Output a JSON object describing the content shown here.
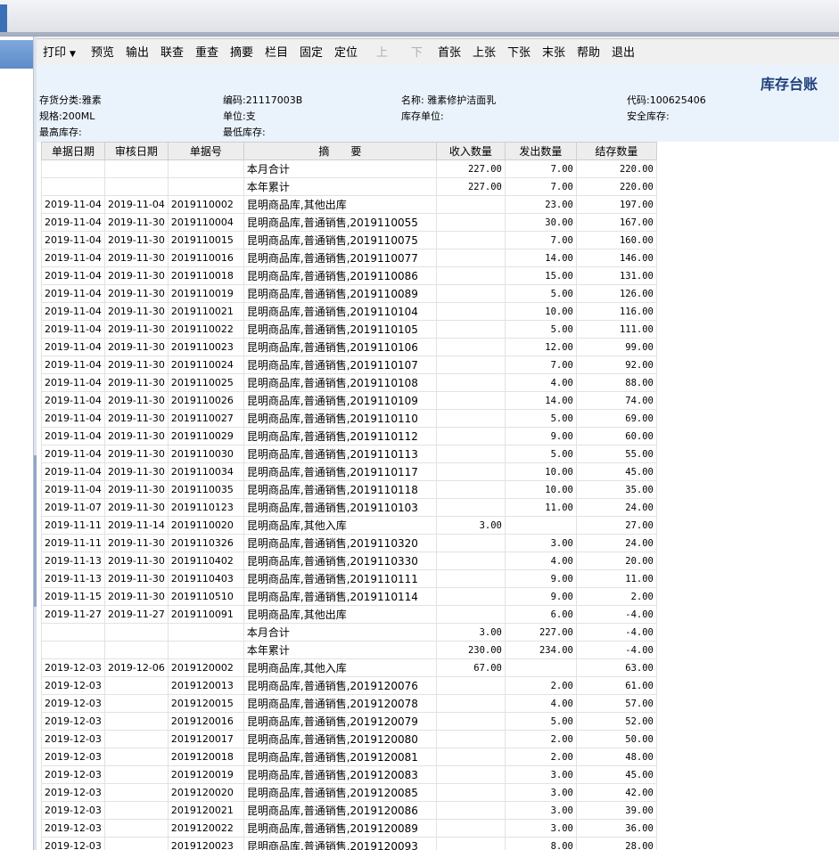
{
  "toolbar": {
    "buttons": [
      {
        "label": "打印",
        "dropdown": true,
        "enabled": true
      },
      {
        "label": "预览",
        "enabled": true
      },
      {
        "label": "输出",
        "enabled": true
      },
      {
        "label": "联查",
        "enabled": true
      },
      {
        "label": "重查",
        "enabled": true
      },
      {
        "label": "摘要",
        "enabled": true
      },
      {
        "label": "栏目",
        "enabled": true
      },
      {
        "label": "固定",
        "enabled": true
      },
      {
        "label": "定位",
        "enabled": true
      },
      {
        "label": "上",
        "enabled": false
      },
      {
        "label": "下",
        "enabled": false
      },
      {
        "label": "首张",
        "enabled": true
      },
      {
        "label": "上张",
        "enabled": true
      },
      {
        "label": "下张",
        "enabled": true
      },
      {
        "label": "末张",
        "enabled": true
      },
      {
        "label": "帮助",
        "enabled": true
      },
      {
        "label": "退出",
        "enabled": true
      }
    ]
  },
  "header": {
    "title": "库存台账",
    "category": "存货分类:雅素",
    "code": "编码:21117003B",
    "name": "名称: 雅素修护洁面乳",
    "daima": "代码:100625406",
    "spec": "规格:200ML",
    "unit": "单位:支",
    "stock_unit": "库存单位:",
    "safety_stock": "安全库存:",
    "max_stock": "最高库存:",
    "min_stock": "最低库存:"
  },
  "table": {
    "columns": [
      "单据日期",
      "审核日期",
      "单据号",
      "摘　　要",
      "收入数量",
      "发出数量",
      "结存数量"
    ],
    "rows": [
      [
        "",
        "",
        "",
        "本月合计",
        "227.00",
        "7.00",
        "220.00"
      ],
      [
        "",
        "",
        "",
        "本年累计",
        "227.00",
        "7.00",
        "220.00"
      ],
      [
        "2019-11-04",
        "2019-11-04",
        "2019110002",
        "昆明商品库,其他出库",
        "",
        "23.00",
        "197.00"
      ],
      [
        "2019-11-04",
        "2019-11-30",
        "2019110004",
        "昆明商品库,普通销售,2019110055",
        "",
        "30.00",
        "167.00"
      ],
      [
        "2019-11-04",
        "2019-11-30",
        "2019110015",
        "昆明商品库,普通销售,2019110075",
        "",
        "7.00",
        "160.00"
      ],
      [
        "2019-11-04",
        "2019-11-30",
        "2019110016",
        "昆明商品库,普通销售,2019110077",
        "",
        "14.00",
        "146.00"
      ],
      [
        "2019-11-04",
        "2019-11-30",
        "2019110018",
        "昆明商品库,普通销售,2019110086",
        "",
        "15.00",
        "131.00"
      ],
      [
        "2019-11-04",
        "2019-11-30",
        "2019110019",
        "昆明商品库,普通销售,2019110089",
        "",
        "5.00",
        "126.00"
      ],
      [
        "2019-11-04",
        "2019-11-30",
        "2019110021",
        "昆明商品库,普通销售,2019110104",
        "",
        "10.00",
        "116.00"
      ],
      [
        "2019-11-04",
        "2019-11-30",
        "2019110022",
        "昆明商品库,普通销售,2019110105",
        "",
        "5.00",
        "111.00"
      ],
      [
        "2019-11-04",
        "2019-11-30",
        "2019110023",
        "昆明商品库,普通销售,2019110106",
        "",
        "12.00",
        "99.00"
      ],
      [
        "2019-11-04",
        "2019-11-30",
        "2019110024",
        "昆明商品库,普通销售,2019110107",
        "",
        "7.00",
        "92.00"
      ],
      [
        "2019-11-04",
        "2019-11-30",
        "2019110025",
        "昆明商品库,普通销售,2019110108",
        "",
        "4.00",
        "88.00"
      ],
      [
        "2019-11-04",
        "2019-11-30",
        "2019110026",
        "昆明商品库,普通销售,2019110109",
        "",
        "14.00",
        "74.00"
      ],
      [
        "2019-11-04",
        "2019-11-30",
        "2019110027",
        "昆明商品库,普通销售,2019110110",
        "",
        "5.00",
        "69.00"
      ],
      [
        "2019-11-04",
        "2019-11-30",
        "2019110029",
        "昆明商品库,普通销售,2019110112",
        "",
        "9.00",
        "60.00"
      ],
      [
        "2019-11-04",
        "2019-11-30",
        "2019110030",
        "昆明商品库,普通销售,2019110113",
        "",
        "5.00",
        "55.00"
      ],
      [
        "2019-11-04",
        "2019-11-30",
        "2019110034",
        "昆明商品库,普通销售,2019110117",
        "",
        "10.00",
        "45.00"
      ],
      [
        "2019-11-04",
        "2019-11-30",
        "2019110035",
        "昆明商品库,普通销售,2019110118",
        "",
        "10.00",
        "35.00"
      ],
      [
        "2019-11-07",
        "2019-11-30",
        "2019110123",
        "昆明商品库,普通销售,2019110103",
        "",
        "11.00",
        "24.00"
      ],
      [
        "2019-11-11",
        "2019-11-14",
        "2019110020",
        "昆明商品库,其他入库",
        "3.00",
        "",
        "27.00"
      ],
      [
        "2019-11-11",
        "2019-11-30",
        "2019110326",
        "昆明商品库,普通销售,2019110320",
        "",
        "3.00",
        "24.00"
      ],
      [
        "2019-11-13",
        "2019-11-30",
        "2019110402",
        "昆明商品库,普通销售,2019110330",
        "",
        "4.00",
        "20.00"
      ],
      [
        "2019-11-13",
        "2019-11-30",
        "2019110403",
        "昆明商品库,普通销售,2019110111",
        "",
        "9.00",
        "11.00"
      ],
      [
        "2019-11-15",
        "2019-11-30",
        "2019110510",
        "昆明商品库,普通销售,2019110114",
        "",
        "9.00",
        "2.00"
      ],
      [
        "2019-11-27",
        "2019-11-27",
        "2019110091",
        "昆明商品库,其他出库",
        "",
        "6.00",
        "-4.00"
      ],
      [
        "",
        "",
        "",
        "本月合计",
        "3.00",
        "227.00",
        "-4.00"
      ],
      [
        "",
        "",
        "",
        "本年累计",
        "230.00",
        "234.00",
        "-4.00"
      ],
      [
        "2019-12-03",
        "2019-12-06",
        "2019120002",
        "昆明商品库,其他入库",
        "67.00",
        "",
        "63.00"
      ],
      [
        "2019-12-03",
        "",
        "2019120013",
        "昆明商品库,普通销售,2019120076",
        "",
        "2.00",
        "61.00"
      ],
      [
        "2019-12-03",
        "",
        "2019120015",
        "昆明商品库,普通销售,2019120078",
        "",
        "4.00",
        "57.00"
      ],
      [
        "2019-12-03",
        "",
        "2019120016",
        "昆明商品库,普通销售,2019120079",
        "",
        "5.00",
        "52.00"
      ],
      [
        "2019-12-03",
        "",
        "2019120017",
        "昆明商品库,普通销售,2019120080",
        "",
        "2.00",
        "50.00"
      ],
      [
        "2019-12-03",
        "",
        "2019120018",
        "昆明商品库,普通销售,2019120081",
        "",
        "2.00",
        "48.00"
      ],
      [
        "2019-12-03",
        "",
        "2019120019",
        "昆明商品库,普通销售,2019120083",
        "",
        "3.00",
        "45.00"
      ],
      [
        "2019-12-03",
        "",
        "2019120020",
        "昆明商品库,普通销售,2019120085",
        "",
        "3.00",
        "42.00"
      ],
      [
        "2019-12-03",
        "",
        "2019120021",
        "昆明商品库,普通销售,2019120086",
        "",
        "3.00",
        "39.00"
      ],
      [
        "2019-12-03",
        "",
        "2019120022",
        "昆明商品库,普通销售,2019120089",
        "",
        "3.00",
        "36.00"
      ],
      [
        "2019-12-03",
        "",
        "2019120023",
        "昆明商品库,普通销售,2019120093",
        "",
        "8.00",
        "28.00"
      ]
    ]
  }
}
